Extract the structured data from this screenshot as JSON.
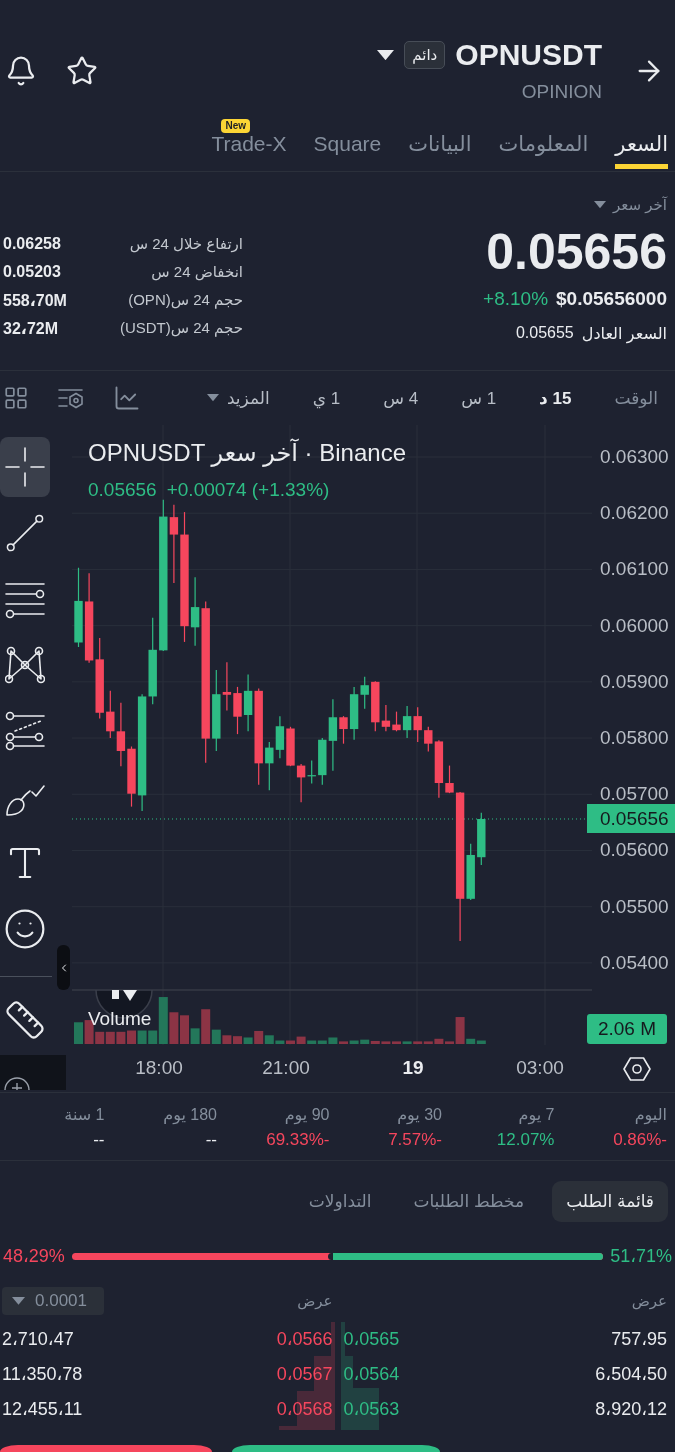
{
  "header": {
    "symbol": "OPNUSDT",
    "badge": "دائم",
    "name": "OPINION"
  },
  "tabs": [
    {
      "label": "السعر",
      "selected": true
    },
    {
      "label": "المعلومات",
      "selected": false
    },
    {
      "label": "البيانات",
      "selected": false
    },
    {
      "label": "Square",
      "selected": false
    },
    {
      "label": "Trade-X",
      "selected": false,
      "badge": "New"
    }
  ],
  "price": {
    "label": "آخر سعر",
    "last": "0.05656",
    "change": "+8.10%",
    "usd": "$0.05656000",
    "fair_label": "السعر العادل",
    "fair": "0.05655"
  },
  "stats": [
    {
      "label": "ارتفاع خلال 24 س",
      "value": "0.06258"
    },
    {
      "label": "انخفاض 24 س",
      "value": "0.05203"
    },
    {
      "label": "حجم 24 س(OPN)",
      "value": "558،70M"
    },
    {
      "label": "حجم 24 س(USDT)",
      "value": "32،72M"
    }
  ],
  "intervals": {
    "label": "الوقت",
    "items": [
      {
        "label": "15 د",
        "selected": true
      },
      {
        "label": "1 س",
        "selected": false
      },
      {
        "label": "4 س",
        "selected": false
      },
      {
        "label": "1 ي",
        "selected": false
      }
    ],
    "more": "المزيد"
  },
  "tools": [
    {
      "kind": "crosshair",
      "selected": true
    },
    {
      "kind": "line",
      "selected": false
    },
    {
      "kind": "hlines",
      "selected": false
    },
    {
      "kind": "pattern",
      "selected": false
    },
    {
      "kind": "fib",
      "selected": false
    },
    {
      "kind": "brush",
      "selected": false
    },
    {
      "kind": "text",
      "selected": false
    },
    {
      "kind": "emoji",
      "selected": false
    }
  ],
  "extra_tools": [
    {
      "kind": "ruler",
      "selected": false
    }
  ],
  "chart": {
    "title": "OPNUSDT آخر سعر · Binance",
    "price": "0.05656",
    "change": "+0.00074 (+1.33%)",
    "y_ticks": [
      "0.06300",
      "0.06200",
      "0.06100",
      "0.06000",
      "0.05900",
      "0.05800",
      "0.05700",
      "0.05600",
      "0.05500",
      "0.05400"
    ],
    "price_tag": "0.05656",
    "volume_label": "Volume",
    "volume_tag": "2.06 M",
    "x_ticks": [
      {
        "label": "03:00",
        "kind": "time"
      },
      {
        "label": "19",
        "kind": "date"
      },
      {
        "label": "21:00",
        "kind": "time"
      },
      {
        "label": "18:00",
        "kind": "time"
      }
    ]
  },
  "periods": [
    {
      "label": "اليوم",
      "value": "0.86%-",
      "color": "#f6465d"
    },
    {
      "label": "7 يوم",
      "value": "12.07%",
      "color": "#2ebd85"
    },
    {
      "label": "30 يوم",
      "value": "7.57%-",
      "color": "#f6465d"
    },
    {
      "label": "90 يوم",
      "value": "69.33%-",
      "color": "#f6465d"
    },
    {
      "label": "180 يوم",
      "value": "--",
      "color": "#eaecef"
    },
    {
      "label": "1 سنة",
      "value": "--",
      "color": "#eaecef"
    }
  ],
  "book": {
    "tabs": [
      {
        "label": "قائمة الطلب",
        "selected": true
      },
      {
        "label": "مخطط الطلبات",
        "selected": false
      },
      {
        "label": "التداولات",
        "selected": false
      }
    ],
    "ratio": {
      "sell": "48،29%",
      "buy": "51،71%",
      "level": 0.517
    },
    "tick": "0.0001",
    "columns": [
      "عرض",
      "عرض"
    ],
    "rows": [
      {
        "bid": {
          "qty": "757،95",
          "price": "0،0565"
        },
        "ask": {
          "price": "0،0566",
          "qty": "2،710،47"
        }
      },
      {
        "bid": {
          "qty": "6،504،50",
          "price": "0،0564"
        },
        "ask": {
          "price": "0،0567",
          "qty": "11،350،78"
        }
      },
      {
        "bid": {
          "qty": "8،920،12",
          "price": "0،0563"
        },
        "ask": {
          "price": "0،0568",
          "qty": "12،455،11"
        }
      }
    ]
  }
}
